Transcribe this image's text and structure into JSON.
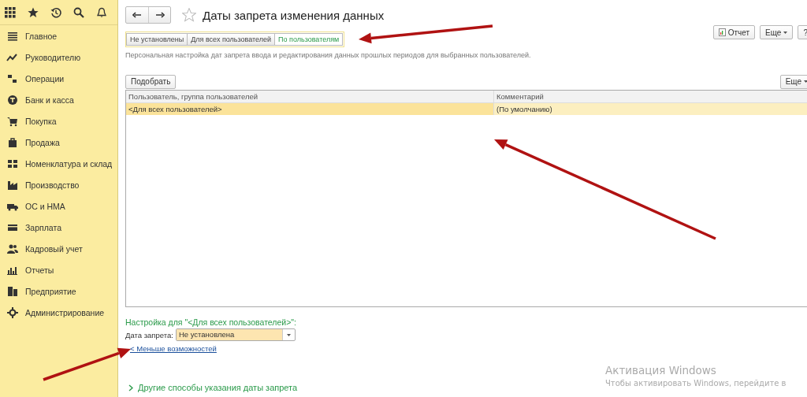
{
  "sidebar": {
    "items": [
      {
        "label": "Главное"
      },
      {
        "label": "Руководителю"
      },
      {
        "label": "Операции"
      },
      {
        "label": "Банк и касса"
      },
      {
        "label": "Покупка"
      },
      {
        "label": "Продажа"
      },
      {
        "label": "Номенклатура и склад"
      },
      {
        "label": "Производство"
      },
      {
        "label": "ОС и НМА"
      },
      {
        "label": "Зарплата"
      },
      {
        "label": "Кадровый учет"
      },
      {
        "label": "Отчеты"
      },
      {
        "label": "Предприятие"
      },
      {
        "label": "Администрирование"
      }
    ]
  },
  "header": {
    "title": "Даты запрета изменения данных",
    "buttons": [
      "Отчет",
      "Еще"
    ],
    "help": "?"
  },
  "mode_tabs": [
    {
      "label": "Не установлены",
      "selected": false
    },
    {
      "label": "Для всех пользователей",
      "selected": false
    },
    {
      "label": "По пользователям",
      "selected": true
    }
  ],
  "description": "Персональная настройка дат запрета ввода и редактирования данных прошлых периодов для выбранных пользователей.",
  "table_toolbar": {
    "pick_button": "Подобрать",
    "more_button": "Еще"
  },
  "table": {
    "columns": [
      "Пользователь, группа пользователей",
      "Комментарий"
    ],
    "rows": [
      {
        "cells": [
          "<Для всех пользователей>",
          "(По умолчанию)"
        ],
        "selected": true
      }
    ]
  },
  "settings": {
    "heading": "Настройка для \"<Для всех пользователей>\":",
    "field_label": "Дата запрета:",
    "field_value": "Не установлена",
    "link": "< Меньше возможностей",
    "other_section": "Другие способы указания даты запрета",
    "other_expanded": false
  },
  "os_overlay": {
    "title": "Активация Windows",
    "text": "Чтобы активировать Windows, перейдите в"
  }
}
